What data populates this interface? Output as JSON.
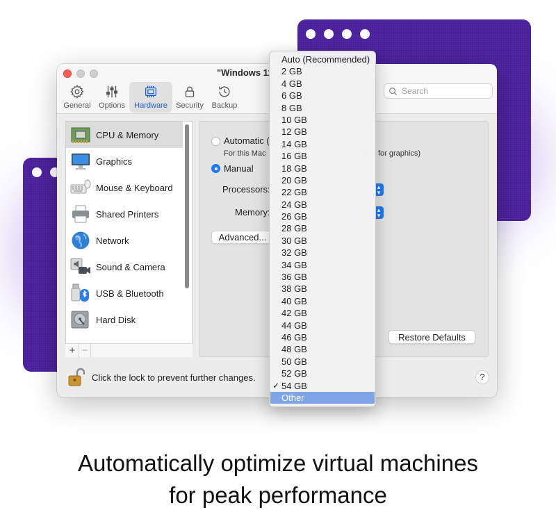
{
  "window": {
    "title": "\"Windows 11"
  },
  "toolbar": {
    "items": [
      {
        "label": "General",
        "icon": "gear-icon"
      },
      {
        "label": "Options",
        "icon": "sliders-icon"
      },
      {
        "label": "Hardware",
        "icon": "chip-icon"
      },
      {
        "label": "Security",
        "icon": "lock-icon"
      },
      {
        "label": "Backup",
        "icon": "clock-arrow-icon"
      }
    ],
    "search_placeholder": "Search"
  },
  "sidebar": {
    "items": [
      {
        "label": "CPU & Memory",
        "icon": "memory-chip-icon"
      },
      {
        "label": "Graphics",
        "icon": "monitor-icon"
      },
      {
        "label": "Mouse & Keyboard",
        "icon": "keyboard-icon"
      },
      {
        "label": "Shared Printers",
        "icon": "printer-icon"
      },
      {
        "label": "Network",
        "icon": "globe-icon"
      },
      {
        "label": "Sound & Camera",
        "icon": "speaker-camera-icon"
      },
      {
        "label": "USB & Bluetooth",
        "icon": "usb-bluetooth-icon"
      },
      {
        "label": "Hard Disk",
        "icon": "hard-disk-icon"
      }
    ],
    "add_label": "+",
    "remove_label": "−"
  },
  "panel": {
    "automatic_label": "Automatic (",
    "for_this_mac": "For this Mac",
    "graphics_note": "GB for graphics)",
    "manual_label": "Manual",
    "processors_label": "Processors:",
    "memory_label": "Memory:",
    "advanced_button": "Advanced...",
    "restore_button": "Restore Defaults"
  },
  "footer": {
    "lock_text": "Click the lock to prevent further changes.",
    "help_label": "?"
  },
  "memory_menu": {
    "items": [
      "Auto (Recommended)",
      "2 GB",
      "4 GB",
      "6 GB",
      "8 GB",
      "10 GB",
      "12 GB",
      "14 GB",
      "16 GB",
      "18 GB",
      "20 GB",
      "22 GB",
      "24 GB",
      "26 GB",
      "28 GB",
      "30 GB",
      "32 GB",
      "34 GB",
      "36 GB",
      "38 GB",
      "40 GB",
      "42 GB",
      "44 GB",
      "46 GB",
      "48 GB",
      "50 GB",
      "52 GB",
      "54 GB",
      "Other"
    ],
    "checked": "54 GB",
    "highlighted": "Other",
    "check_glyph": "✓"
  },
  "headline": {
    "line1": "Automatically optimize virtual machines",
    "line2": "for peak performance"
  },
  "colors": {
    "accent": "#1f7bf2",
    "purple": "#4a1f9c",
    "menu_highlight": "#7ea5e8"
  }
}
